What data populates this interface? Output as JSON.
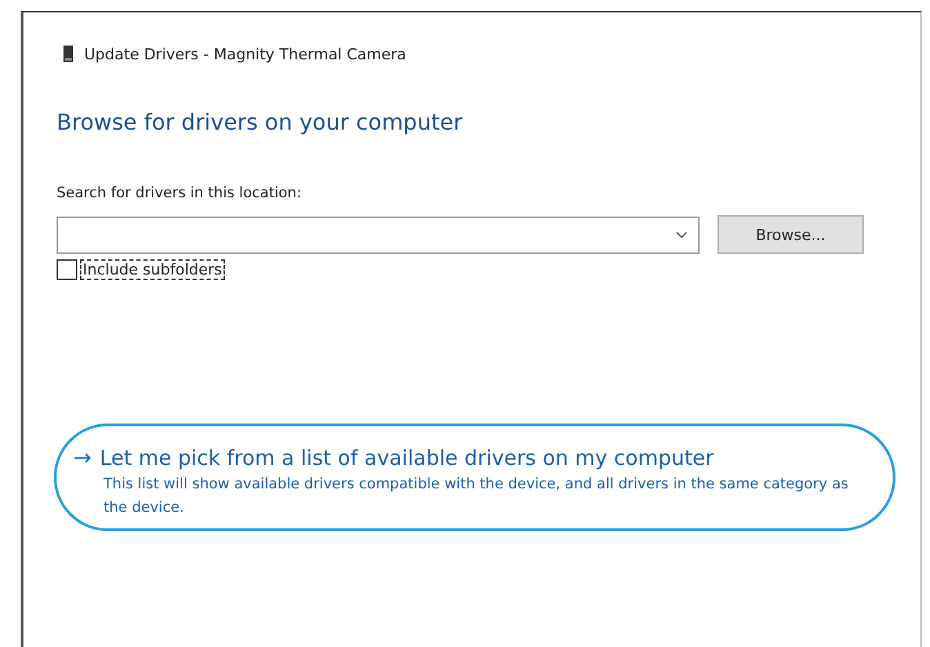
{
  "window": {
    "title": "Update Drivers - Magnity Thermal Camera"
  },
  "heading": "Browse for drivers on your computer",
  "search": {
    "label": "Search for drivers in this location:",
    "browse_button": "Browse..."
  },
  "include_subfolders": {
    "label": "Include subfolders",
    "checked": false,
    "focused": true
  },
  "pick_option": {
    "arrow": "→",
    "title": "Let me pick from a list of available drivers on my computer",
    "description": "This list will show available drivers compatible with the device, and all drivers in the same category as the device.",
    "highlighted": true
  }
}
